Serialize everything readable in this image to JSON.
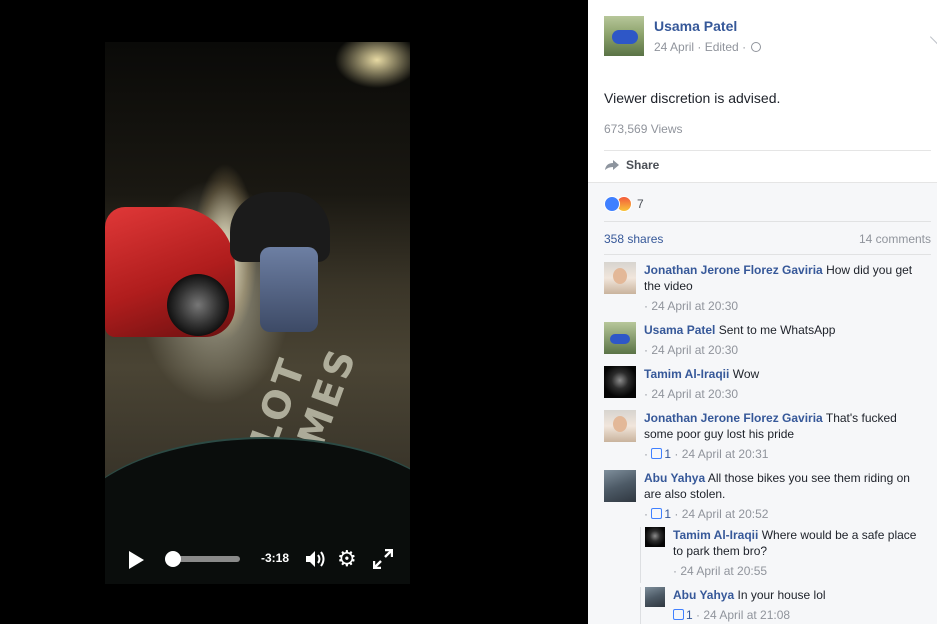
{
  "video": {
    "time_remaining": "-3:18",
    "progress_fraction": 0.1,
    "road_marking": "SLOT TIMES"
  },
  "post": {
    "author": "Usama Patel",
    "date": "24 April",
    "edited": "Edited",
    "text": "Viewer discretion is advised.",
    "views": "673,569 Views",
    "share_label": "Share",
    "reaction_count": "7",
    "shares": "358 shares",
    "comments_count": "14 comments"
  },
  "comments": [
    {
      "author": "Jonathan Jerone Florez Gaviria",
      "text": "How did you get the video",
      "likes": "",
      "time": "24 April at 20:30"
    },
    {
      "author": "Usama Patel",
      "text": "Sent to me WhatsApp",
      "likes": "",
      "time": "24 April at 20:30"
    },
    {
      "author": "Tamim Al-Iraqii",
      "text": "Wow",
      "likes": "",
      "time": "24 April at 20:30"
    },
    {
      "author": "Jonathan Jerone Florez Gaviria",
      "text": "That's fucked some poor guy lost his pride",
      "likes": "1",
      "time": "24 April at 20:31"
    },
    {
      "author": "Abu Yahya",
      "text": "All those bikes you see them riding on are also stolen.",
      "likes": "1",
      "time": "24 April at 20:52"
    }
  ],
  "replies": [
    {
      "author": "Tamim Al-Iraqii",
      "text": "Where would be a safe place to park them bro?",
      "likes": "",
      "time": "24 April at 20:55"
    },
    {
      "author": "Abu Yahya",
      "text": "In your house lol",
      "likes": "1",
      "time": "24 April at 21:08"
    }
  ],
  "colors": {
    "link": "#365899",
    "meta": "#90949c",
    "like_blue": "#4080ff",
    "scrub_blue": "#4b8df8"
  },
  "icons": [
    "play-icon",
    "volume-icon",
    "settings-gear-icon",
    "fullscreen-icon",
    "globe-icon",
    "chevron-down-icon",
    "share-arrow-icon",
    "like-reaction-icon",
    "angry-reaction-icon",
    "thumbs-up-icon"
  ]
}
